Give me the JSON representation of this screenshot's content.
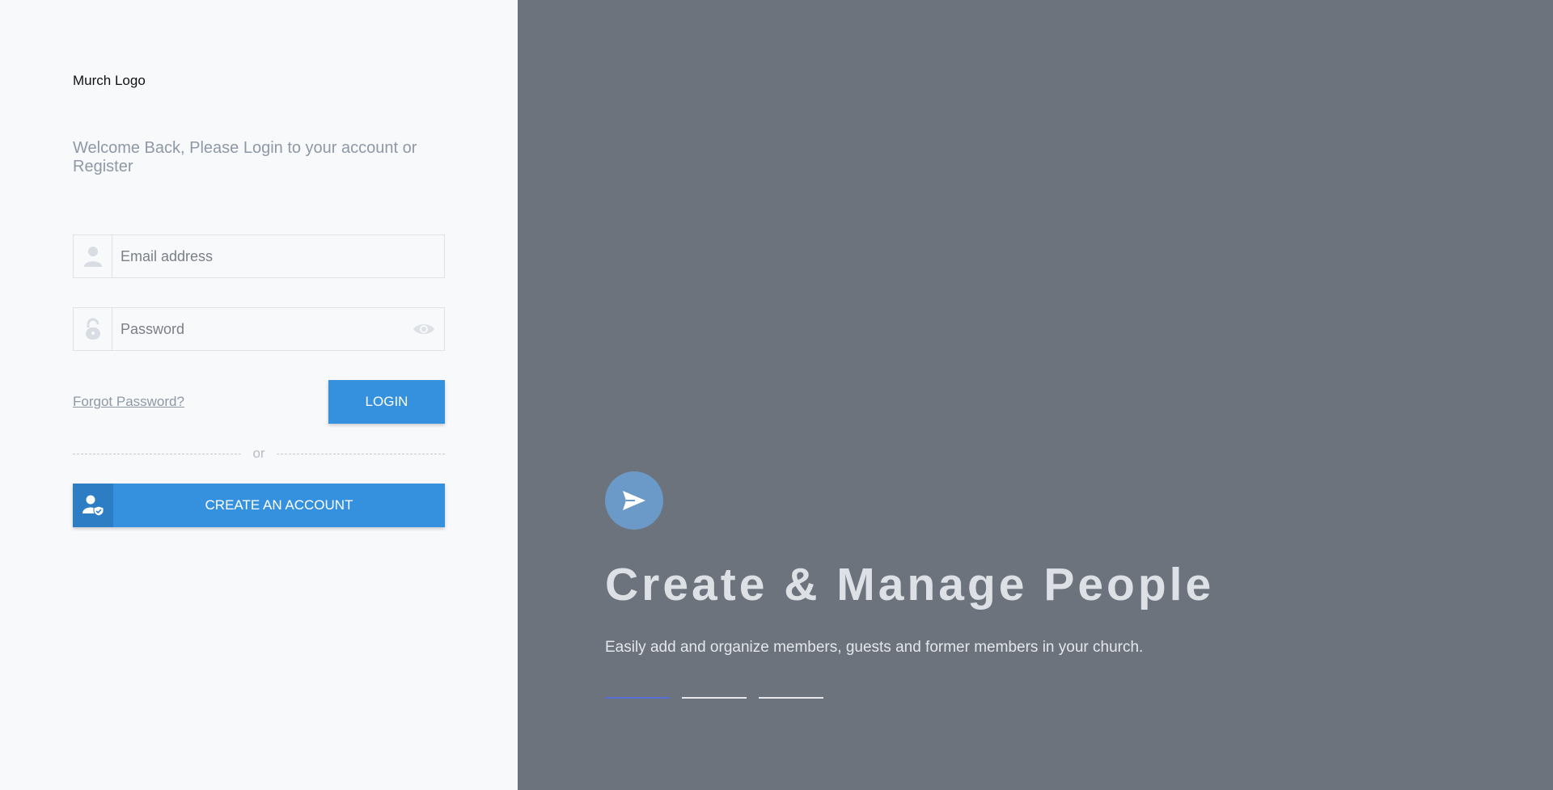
{
  "brand": {
    "logo_text": "Murch Logo"
  },
  "login": {
    "welcome": "Welcome Back, Please Login to your account or Register",
    "email_placeholder": "Email address",
    "password_placeholder": "Password",
    "forgot_label": "Forgot Password?",
    "login_label": "LOGIN",
    "divider_text": "or",
    "create_label": "CREATE AN ACCOUNT"
  },
  "hero": {
    "icon": "send-icon",
    "headline": "Create & Manage People",
    "subtext": "Easily add and organize members, guests and former members in your church.",
    "slides_total": 3,
    "active_slide": 1
  },
  "colors": {
    "primary": "#3590de",
    "primary_dark": "#2c7dc4",
    "hero_bg": "#6c737c",
    "active_indicator": "#5a6fd6"
  }
}
